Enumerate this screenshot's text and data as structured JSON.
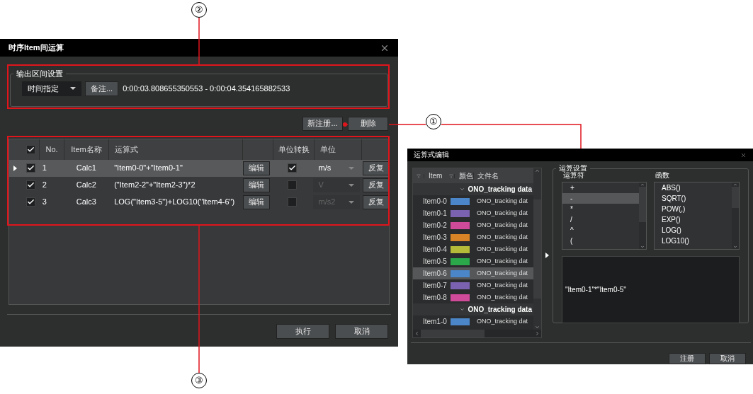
{
  "main_dialog": {
    "title": "时序Item间运算",
    "output_range": {
      "label": "输出区间设置",
      "mode": "时间指定",
      "note_button": "备注...",
      "range": "0:00:03.808655350553 - 0:00:04.354165882533"
    },
    "top_buttons": [
      "新注册...",
      "删除"
    ],
    "table": {
      "columns": [
        "No.",
        "Item名称",
        "运算式",
        "单位转换",
        "单位"
      ],
      "all_checked": true,
      "rows": [
        {
          "selected": true,
          "checked": true,
          "no": "1",
          "name": "Calc1",
          "formula": "\"Item0-0\"+\"Item0-1\"",
          "edit": "编辑",
          "convert": true,
          "unit": "m/s",
          "reset": "反复"
        },
        {
          "selected": false,
          "checked": true,
          "no": "2",
          "name": "Calc2",
          "formula": "(\"Item2-2\"+\"Item2-3\")*2",
          "edit": "编辑",
          "convert": false,
          "unit": "V",
          "reset": "反复"
        },
        {
          "selected": false,
          "checked": true,
          "no": "3",
          "name": "Calc3",
          "formula": "LOG(\"Item3-5\")+LOG10(\"Item4-6\")",
          "edit": "编辑",
          "convert": false,
          "unit": "m/s2",
          "reset": "反复"
        }
      ]
    },
    "bottom_buttons": [
      "执行",
      "取消"
    ]
  },
  "editor_dialog": {
    "title": "运算式编辑",
    "item_columns": [
      "Item",
      "颜色",
      "文件名"
    ],
    "groups": [
      {
        "name": "ONO_tracking data",
        "expanded": true,
        "items": [
          {
            "name": "Item0-0",
            "color": "#4a86c8",
            "file": "ONO_tracking dat",
            "selected": false
          },
          {
            "name": "Item0-1",
            "color": "#7a62b0",
            "file": "ONO_tracking dat",
            "selected": false
          },
          {
            "name": "Item0-2",
            "color": "#d04a9a",
            "file": "ONO_tracking dat",
            "selected": false
          },
          {
            "name": "Item0-3",
            "color": "#d88326",
            "file": "ONO_tracking dat",
            "selected": false
          },
          {
            "name": "Item0-4",
            "color": "#b5bb38",
            "file": "ONO_tracking dat",
            "selected": false
          },
          {
            "name": "Item0-5",
            "color": "#2aa84a",
            "file": "ONO_tracking dat",
            "selected": false
          },
          {
            "name": "Item0-6",
            "color": "#4a86c8",
            "file": "ONO_tracking dat",
            "selected": true
          },
          {
            "name": "Item0-7",
            "color": "#7a62b0",
            "file": "ONO_tracking dat",
            "selected": false
          },
          {
            "name": "Item0-8",
            "color": "#d04a9a",
            "file": "ONO_tracking dat",
            "selected": false
          }
        ]
      },
      {
        "name": "ONO_tracking data",
        "expanded": true,
        "items": [
          {
            "name": "Item1-0",
            "color": "#4a86c8",
            "file": "ONO_tracking dat",
            "selected": false
          }
        ]
      }
    ],
    "settings": {
      "label": "运算设置",
      "operators_label": "运算符",
      "operators": [
        {
          "symbol": "+",
          "selected": false
        },
        {
          "symbol": "-",
          "selected": true
        },
        {
          "symbol": "*",
          "selected": false
        },
        {
          "symbol": "/",
          "selected": false
        },
        {
          "symbol": "^",
          "selected": false
        },
        {
          "symbol": "(",
          "selected": false
        }
      ],
      "functions_label": "函数",
      "functions": [
        "ABS()",
        "SQRT()",
        "POW(,)",
        "EXP()",
        "LOG()",
        "LOG10()"
      ],
      "expression": "\"Item0-1\"*\"Item0-5\""
    },
    "buttons": [
      "注册",
      "取消"
    ]
  },
  "callouts": [
    "①",
    "②",
    "③"
  ]
}
